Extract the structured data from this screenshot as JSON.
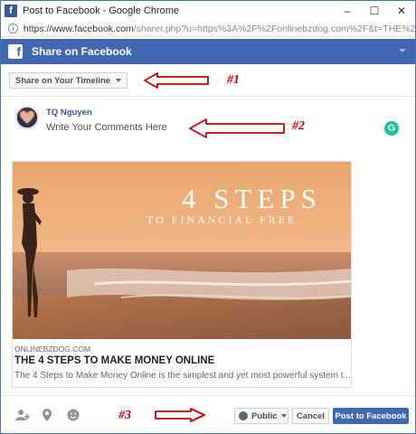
{
  "window": {
    "title": "Post to Facebook - Google Chrome",
    "url_prefix": "https://www.facebook.com",
    "url_rest": "/sharer.php?u=https%3A%2F%2Fonlinebzdog.com%2F&t=THE%2...",
    "minimize": "–",
    "maximize": "☐",
    "close": "✕"
  },
  "header": {
    "title": "Share on Facebook",
    "logo": "f"
  },
  "share_target": {
    "label": "Share on Your Timeline"
  },
  "composer": {
    "user_name": "TQ Nguyen",
    "placeholder": "Write Your Comments Here",
    "grammarly": "G"
  },
  "link_preview": {
    "image_text_big": "4 STEPS",
    "image_text_small": "TO FINANCIAL FREE",
    "domain": "ONLINEBZDOG.COM",
    "title": "THE 4 STEPS TO MAKE MONEY ONLINE",
    "description": "The 4 Steps to Make Money Online is the simplest and yet most powerful system t..."
  },
  "footer": {
    "privacy_label": "Public",
    "cancel_label": "Cancel",
    "post_label": "Post to Facebook",
    "icons": [
      "tag-people-icon",
      "location-icon",
      "feeling-icon"
    ]
  },
  "annotations": {
    "one": "#1",
    "two": "#2",
    "three": "#3"
  },
  "colors": {
    "facebook_blue": "#4267b2",
    "annotation_red": "#cc0000",
    "grammarly_green": "#15c39a"
  }
}
